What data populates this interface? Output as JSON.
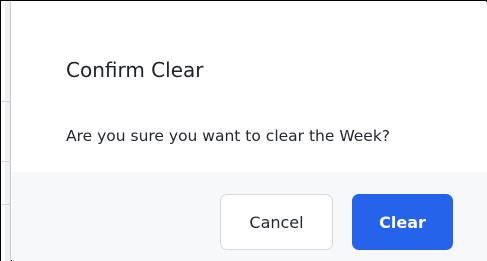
{
  "dialog": {
    "title": "Confirm Clear",
    "message": "Are you sure you want to clear the Week?",
    "cancel_label": "Cancel",
    "confirm_label": "Clear"
  },
  "colors": {
    "primary": "#2563eb",
    "footer_bg": "#f7f8fa",
    "text": "#1f2328"
  }
}
